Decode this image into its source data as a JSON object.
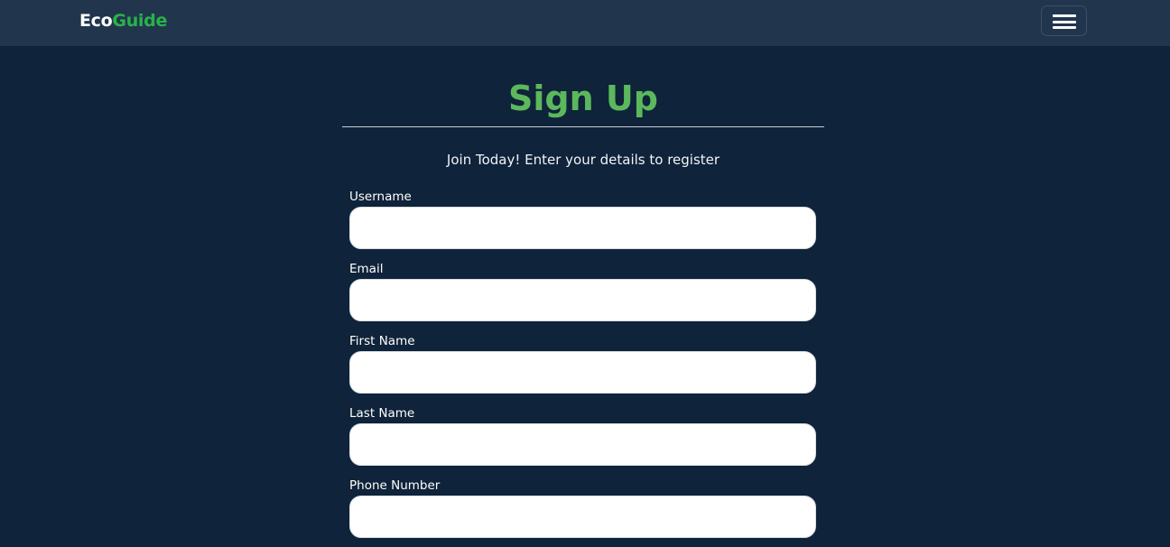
{
  "navbar": {
    "brand_part1": "Eco",
    "brand_part2": "Guide",
    "menu_icon": "hamburger-menu-icon"
  },
  "page": {
    "title": "Sign Up",
    "subtitle": "Join Today! Enter your details to register"
  },
  "form": {
    "fields": [
      {
        "label": "Username",
        "value": "",
        "placeholder": ""
      },
      {
        "label": "Email",
        "value": "",
        "placeholder": ""
      },
      {
        "label": "First Name",
        "value": "",
        "placeholder": ""
      },
      {
        "label": "Last Name",
        "value": "",
        "placeholder": ""
      },
      {
        "label": "Phone Number",
        "value": "",
        "placeholder": ""
      }
    ]
  },
  "colors": {
    "background": "#0f233a",
    "navbar": "#21364d",
    "brand_accent": "#28b24a",
    "title": "#5cb85c"
  }
}
